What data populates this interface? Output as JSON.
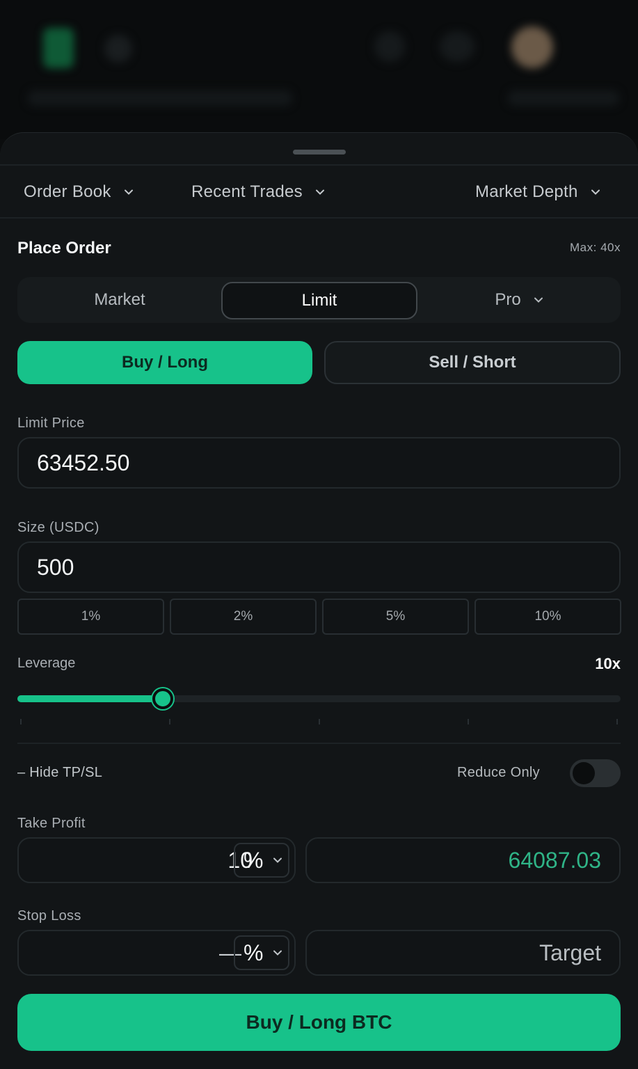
{
  "tabs": [
    {
      "label": "Order Book"
    },
    {
      "label": "Recent Trades"
    },
    {
      "label": "Market Depth"
    }
  ],
  "order": {
    "title": "Place Order",
    "max_leverage": "Max: 40x",
    "order_types": [
      "Market",
      "Limit",
      "Pro"
    ],
    "active_order_type": "Limit",
    "buy_label": "Buy / Long",
    "sell_label": "Sell / Short",
    "limit_price_label": "Limit Price",
    "limit_price_value": "63452.50",
    "size_label": "Size (USDC)",
    "size_value": "500",
    "size_percent_options": [
      "1%",
      "2%",
      "5%",
      "10%"
    ],
    "leverage_label": "Leverage",
    "leverage_value": "10x",
    "leverage_fraction": 0.25,
    "hide_tpsl_label": "– Hide TP/SL",
    "reduce_only_label": "Reduce Only",
    "reduce_only_on": false,
    "take_profit_label": "Take Profit",
    "take_profit_percent": "10",
    "take_profit_unit": "%",
    "take_profit_price": "64087.03",
    "stop_loss_label": "Stop Loss",
    "stop_loss_percent": "—",
    "stop_loss_unit": "%",
    "stop_loss_placeholder": "Target",
    "submit_label": "Buy / Long BTC"
  },
  "colors": {
    "accent": "#17c28a",
    "background": "#121517",
    "take_profit_text": "#2fb487",
    "placeholder_text": "#b9bec2"
  }
}
